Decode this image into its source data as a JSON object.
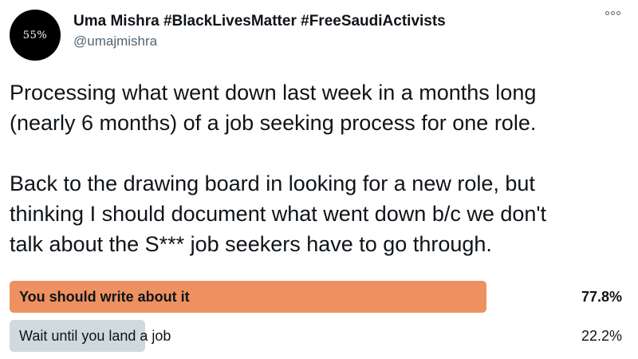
{
  "author": {
    "avatar_text": "55%",
    "display_name": "Uma Mishra #BlackLivesMatter #FreeSaudiActivists",
    "handle": "@umajmishra"
  },
  "header": {
    "more_icon": "more-options-icon"
  },
  "tweet": {
    "paragraph1_line1": "Processing what went down last week in a months long",
    "paragraph1_line2": "(nearly 6 months) of a job seeking process for one role.",
    "paragraph2_line1": "Back to the drawing board in looking for a new role, but",
    "paragraph2_line2": "thinking I should document what went down b/c we don't",
    "paragraph2_line3": "talk about the S*** job seekers have to go through."
  },
  "poll": {
    "options": [
      {
        "label": "You should write about it",
        "percent": "77.8%",
        "fraction": 0.778,
        "bar_color": "#ee9160",
        "winner": true
      },
      {
        "label": "Wait until you land a job",
        "percent": "22.2%",
        "fraction": 0.222,
        "bar_color": "#cfd9de",
        "winner": false
      }
    ]
  }
}
